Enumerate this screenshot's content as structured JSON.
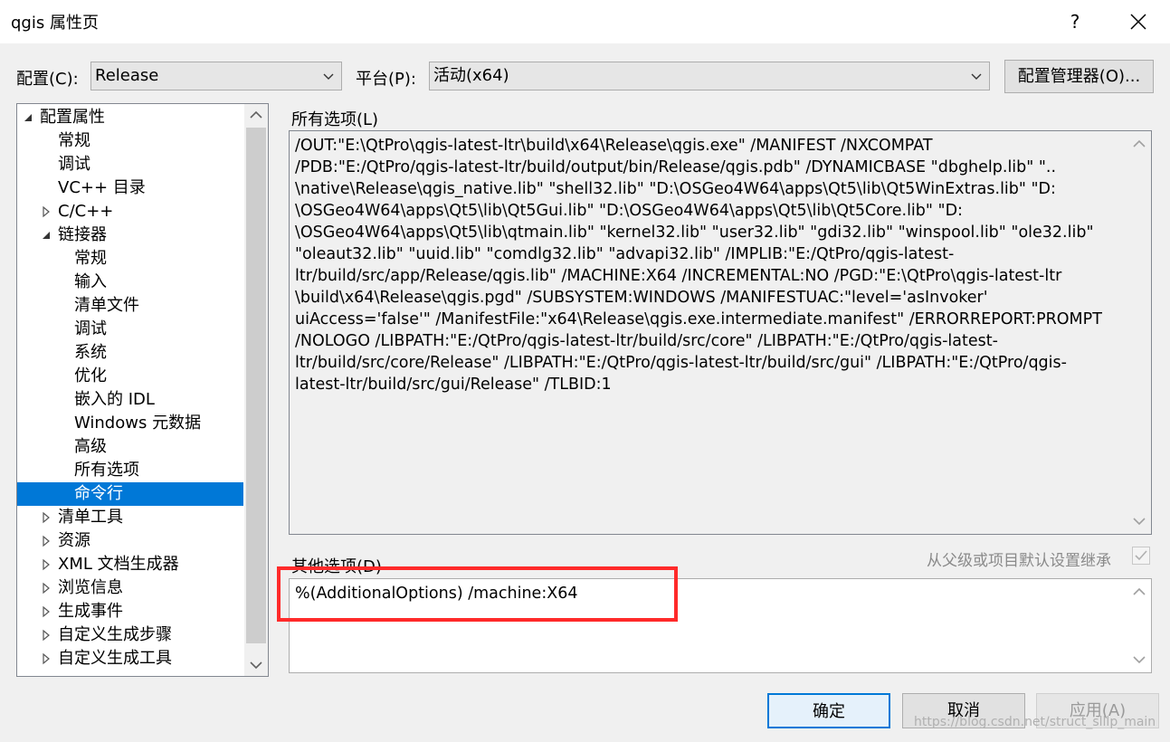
{
  "window": {
    "title": "qgis 属性页",
    "help_glyph": "?",
    "close_glyph": "✕"
  },
  "config": {
    "label": "配置(C):",
    "value": "Release"
  },
  "platform": {
    "label": "平台(P):",
    "value": "活动(x64)"
  },
  "config_manager_label": "配置管理器(O)...",
  "tree": {
    "items": [
      {
        "label": "配置属性",
        "level": 0,
        "expander": "expanded"
      },
      {
        "label": "常规",
        "level": 1,
        "expander": "none"
      },
      {
        "label": "调试",
        "level": 1,
        "expander": "none"
      },
      {
        "label": "VC++ 目录",
        "level": 1,
        "expander": "none"
      },
      {
        "label": "C/C++",
        "level": 1,
        "expander": "collapsed"
      },
      {
        "label": "链接器",
        "level": 1,
        "expander": "expanded"
      },
      {
        "label": "常规",
        "level": 2,
        "expander": "none"
      },
      {
        "label": "输入",
        "level": 2,
        "expander": "none"
      },
      {
        "label": "清单文件",
        "level": 2,
        "expander": "none"
      },
      {
        "label": "调试",
        "level": 2,
        "expander": "none"
      },
      {
        "label": "系统",
        "level": 2,
        "expander": "none"
      },
      {
        "label": "优化",
        "level": 2,
        "expander": "none"
      },
      {
        "label": "嵌入的 IDL",
        "level": 2,
        "expander": "none"
      },
      {
        "label": "Windows 元数据",
        "level": 2,
        "expander": "none"
      },
      {
        "label": "高级",
        "level": 2,
        "expander": "none"
      },
      {
        "label": "所有选项",
        "level": 2,
        "expander": "none"
      },
      {
        "label": "命令行",
        "level": 2,
        "expander": "none",
        "selected": true
      },
      {
        "label": "清单工具",
        "level": 1,
        "expander": "collapsed"
      },
      {
        "label": "资源",
        "level": 1,
        "expander": "collapsed"
      },
      {
        "label": "XML 文档生成器",
        "level": 1,
        "expander": "collapsed"
      },
      {
        "label": "浏览信息",
        "level": 1,
        "expander": "collapsed"
      },
      {
        "label": "生成事件",
        "level": 1,
        "expander": "collapsed"
      },
      {
        "label": "自定义生成步骤",
        "level": 1,
        "expander": "collapsed"
      },
      {
        "label": "自定义生成工具",
        "level": 1,
        "expander": "collapsed"
      }
    ]
  },
  "all_options": {
    "label": "所有选项(L)",
    "lines": [
      "/OUT:\"E:\\QtPro\\qgis-latest-ltr\\build\\x64\\Release\\qgis.exe\" /MANIFEST /NXCOMPAT",
      "/PDB:\"E:/QtPro/qgis-latest-ltr/build/output/bin/Release/qgis.pdb\" /DYNAMICBASE \"dbghelp.lib\" \"..",
      "\\native\\Release\\qgis_native.lib\" \"shell32.lib\" \"D:\\OSGeo4W64\\apps\\Qt5\\lib\\Qt5WinExtras.lib\" \"D:",
      "\\OSGeo4W64\\apps\\Qt5\\lib\\Qt5Gui.lib\" \"D:\\OSGeo4W64\\apps\\Qt5\\lib\\Qt5Core.lib\" \"D:",
      "\\OSGeo4W64\\apps\\Qt5\\lib\\qtmain.lib\" \"kernel32.lib\" \"user32.lib\" \"gdi32.lib\" \"winspool.lib\" \"ole32.lib\"",
      "\"oleaut32.lib\" \"uuid.lib\" \"comdlg32.lib\" \"advapi32.lib\" /IMPLIB:\"E:/QtPro/qgis-latest-",
      "ltr/build/src/app/Release/qgis.lib\" /MACHINE:X64 /INCREMENTAL:NO /PGD:\"E:\\QtPro\\qgis-latest-ltr",
      "\\build\\x64\\Release\\qgis.pgd\" /SUBSYSTEM:WINDOWS /MANIFESTUAC:\"level='asInvoker'",
      "uiAccess='false'\" /ManifestFile:\"x64\\Release\\qgis.exe.intermediate.manifest\" /ERRORREPORT:PROMPT",
      "/NOLOGO /LIBPATH:\"E:/QtPro/qgis-latest-ltr/build/src/core\" /LIBPATH:\"E:/QtPro/qgis-latest-",
      "ltr/build/src/core/Release\" /LIBPATH:\"E:/QtPro/qgis-latest-ltr/build/src/gui\" /LIBPATH:\"E:/QtPro/qgis-",
      "latest-ltr/build/src/gui/Release\" /TLBID:1"
    ]
  },
  "other_options": {
    "label": "其他选项(D)",
    "value": "%(AdditionalOptions) /machine:X64",
    "inherit_label": "从父级或项目默认设置继承",
    "inherit_checked": true
  },
  "buttons": {
    "ok": "确定",
    "cancel": "取消",
    "apply": "应用(A)"
  },
  "watermark": "https://blog.csdn.net/struct_slllp_main",
  "colors": {
    "selection": "#0078d7",
    "highlight_box": "#ff2a2a"
  }
}
